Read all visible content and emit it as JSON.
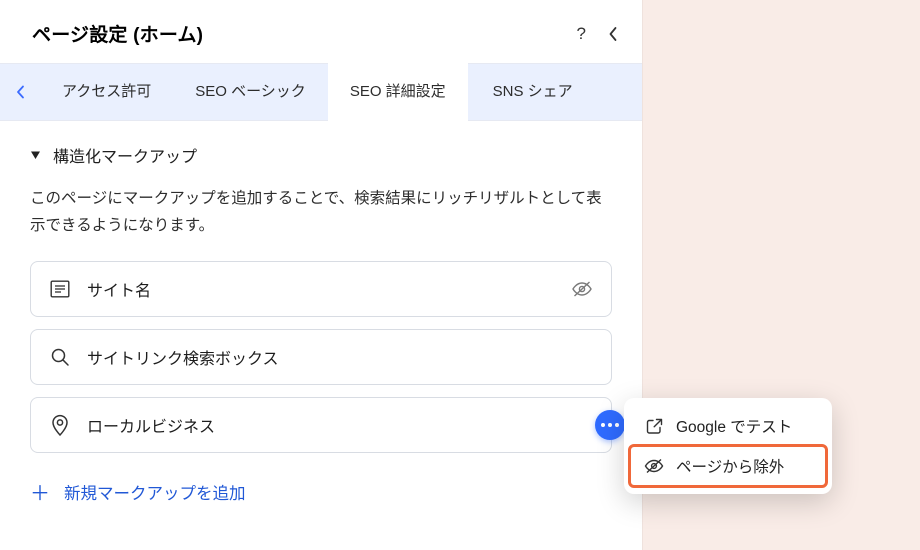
{
  "header": {
    "title": "ページ設定 (ホーム)"
  },
  "tabs": {
    "items": [
      {
        "label": "アクセス許可"
      },
      {
        "label": "SEO ベーシック"
      },
      {
        "label": "SEO 詳細設定"
      },
      {
        "label": "SNS シェア"
      }
    ],
    "active_index": 2
  },
  "section": {
    "title": "構造化マークアップ",
    "description": "このページにマークアップを追加することで、検索結果にリッチリザルトとして表示できるようになります。"
  },
  "markups": [
    {
      "icon": "document-icon",
      "label": "サイト名",
      "has_eye_off": true
    },
    {
      "icon": "search-icon",
      "label": "サイトリンク検索ボックス",
      "has_eye_off": false
    },
    {
      "icon": "pin-icon",
      "label": "ローカルビジネス",
      "has_eye_off": false,
      "has_dots": true
    }
  ],
  "add_markup_label": "新規マークアップを追加",
  "popover": {
    "items": [
      {
        "icon": "external-link-icon",
        "label": "Google でテスト"
      },
      {
        "icon": "eye-off-icon",
        "label": "ページから除外",
        "highlight": true
      }
    ]
  }
}
